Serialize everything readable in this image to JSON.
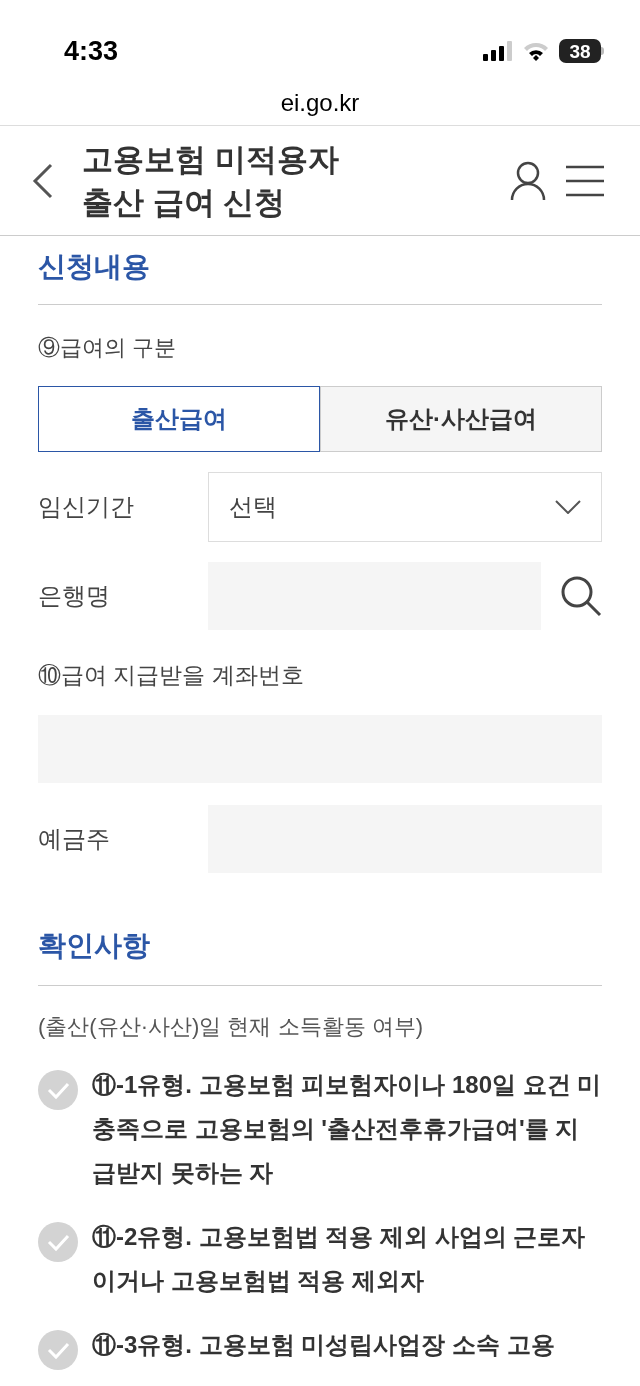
{
  "status_bar": {
    "time": "4:33",
    "battery": "38"
  },
  "url_bar": {
    "url": "ei.go.kr"
  },
  "header": {
    "title_lines": [
      "고용보험 미적용자",
      "출산 급여 신청"
    ]
  },
  "application_section": {
    "title": "신청내용",
    "benefit_type": {
      "label": "⑨급여의 구분",
      "options": [
        {
          "label": "출산급여",
          "selected": true
        },
        {
          "label": "유산·사산급여",
          "selected": false
        }
      ]
    },
    "pregnancy_period": {
      "label": "임신기간",
      "value": "선택"
    },
    "bank_name": {
      "label": "은행명"
    },
    "account_number": {
      "label": "⑩급여 지급받을 계좌번호"
    },
    "account_holder": {
      "label": "예금주"
    }
  },
  "confirmation_section": {
    "title": "확인사항",
    "note": "(출산(유산·사산)일 현재 소득활동 여부)",
    "options": [
      {
        "text": "⑪-1유형. 고용보험 피보험자이나 180일 요건 미충족으로 고용보험의 '출산전후휴가급여'를 지급받지 못하는 자",
        "checked": false
      },
      {
        "text": "⑪-2유형. 고용보험법 적용 제외 사업의 근로자이거나 고용보험법 적용 제외자",
        "checked": false
      },
      {
        "text": "⑪-3유형. 고용보험 미성립사업장 소속 고용",
        "checked": false
      }
    ]
  }
}
